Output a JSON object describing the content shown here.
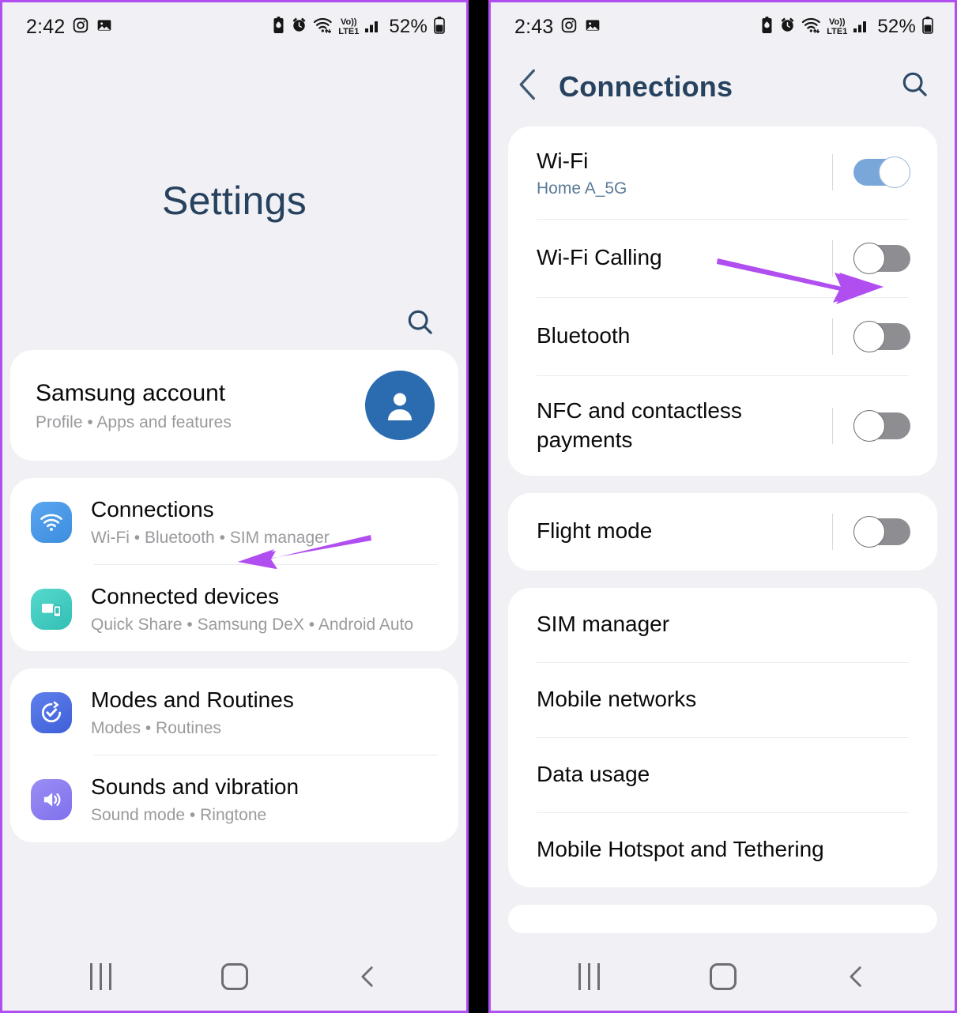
{
  "accent": {
    "annotation_purple": "#b14ef0",
    "title_navy": "#26425e",
    "toggle_on": "#7aa7d9",
    "toggle_off": "#8d8d92"
  },
  "left_phone": {
    "status_bar": {
      "time": "2:42",
      "battery_percent": "52%",
      "network_label_top": "Vo))",
      "network_label_bottom": "LTE1",
      "left_icons": [
        "instagram-icon",
        "gallery-icon"
      ],
      "right_icons": [
        "battery-saver-icon",
        "alarm-icon",
        "wifi-icon",
        "volte-icon",
        "signal-bars-icon",
        "battery-icon"
      ]
    },
    "page_title": "Settings",
    "search_icon": "search-icon",
    "account": {
      "title": "Samsung account",
      "subtitle": "Profile • Apps and features",
      "avatar": "person-avatar-icon"
    },
    "groups": [
      {
        "items": [
          {
            "title": "Connections",
            "subtitle": "Wi-Fi • Bluetooth • SIM manager",
            "icon": "wifi-icon",
            "icon_color": "#3d8ee0"
          },
          {
            "title": "Connected devices",
            "subtitle": "Quick Share • Samsung DeX • Android Auto",
            "icon": "devices-icon",
            "icon_color": "#3fc8bd"
          }
        ]
      },
      {
        "items": [
          {
            "title": "Modes and Routines",
            "subtitle": "Modes • Routines",
            "icon": "check-circle-icon",
            "icon_color": "#4b6ee0"
          },
          {
            "title": "Sounds and vibration",
            "subtitle": "Sound mode • Ringtone",
            "icon": "speaker-icon",
            "icon_color": "#8a7df0"
          }
        ]
      }
    ],
    "nav_bar": {
      "recents": "recents-icon",
      "home": "home-icon",
      "back": "back-icon"
    }
  },
  "right_phone": {
    "status_bar": {
      "time": "2:43",
      "battery_percent": "52%",
      "network_label_top": "Vo))",
      "network_label_bottom": "LTE1",
      "left_icons": [
        "instagram-icon",
        "gallery-icon"
      ],
      "right_icons": [
        "battery-saver-icon",
        "alarm-icon",
        "wifi-icon",
        "volte-icon",
        "signal-bars-icon",
        "battery-icon"
      ]
    },
    "header": {
      "back_icon": "back-chevron-icon",
      "title": "Connections",
      "search_icon": "search-icon"
    },
    "groups": [
      {
        "rows": [
          {
            "title": "Wi-Fi",
            "subtitle": "Home A_5G",
            "toggle": "on"
          },
          {
            "title": "Wi-Fi Calling",
            "subtitle": "",
            "toggle": "off"
          },
          {
            "title": "Bluetooth",
            "subtitle": "",
            "toggle": "off"
          },
          {
            "title": "NFC and contactless payments",
            "subtitle": "",
            "toggle": "off"
          }
        ]
      },
      {
        "rows": [
          {
            "title": "Flight mode",
            "subtitle": "",
            "toggle": "off"
          }
        ]
      },
      {
        "rows": [
          {
            "title": "SIM manager",
            "subtitle": "",
            "toggle": "none"
          },
          {
            "title": "Mobile networks",
            "subtitle": "",
            "toggle": "none"
          },
          {
            "title": "Data usage",
            "subtitle": "",
            "toggle": "none"
          },
          {
            "title": "Mobile Hotspot and Tethering",
            "subtitle": "",
            "toggle": "none"
          }
        ]
      }
    ],
    "nav_bar": {
      "recents": "recents-icon",
      "home": "home-icon",
      "back": "back-icon"
    }
  },
  "annotations": [
    {
      "name": "arrow-to-connections",
      "direction": "left",
      "target": "Connections"
    },
    {
      "name": "arrow-to-wifi-calling-toggle",
      "direction": "right",
      "target": "Wi-Fi Calling toggle"
    }
  ]
}
